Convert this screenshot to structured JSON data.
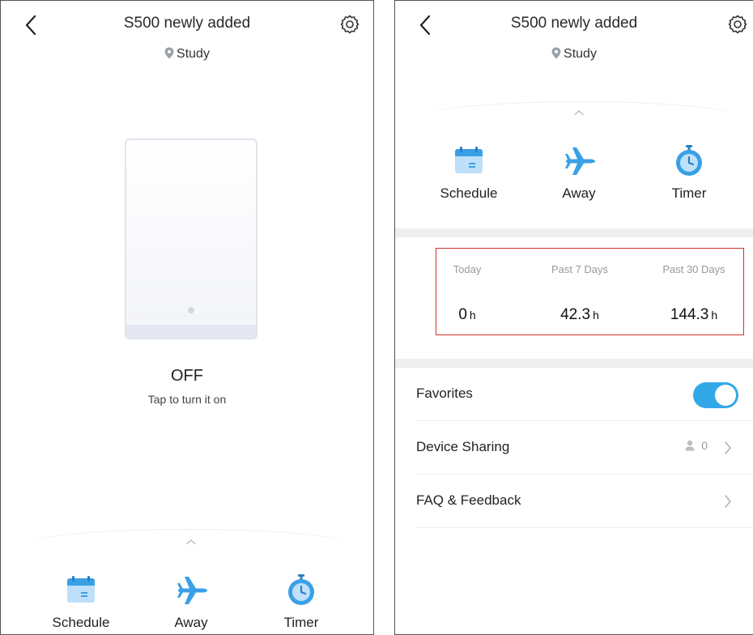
{
  "colors": {
    "accent": "#33a8e8",
    "highlight_box": "#d0312d",
    "divider": "#efefef"
  },
  "left": {
    "title": "S500 newly added",
    "location": "Study",
    "device_state": "OFF",
    "device_hint": "Tap to turn it on",
    "features": [
      {
        "label": "Schedule",
        "icon": "calendar-icon"
      },
      {
        "label": "Away",
        "icon": "airplane-icon"
      },
      {
        "label": "Timer",
        "icon": "stopwatch-icon"
      }
    ]
  },
  "right": {
    "title": "S500 newly added",
    "location": "Study",
    "features": [
      {
        "label": "Schedule",
        "icon": "calendar-icon"
      },
      {
        "label": "Away",
        "icon": "airplane-icon"
      },
      {
        "label": "Timer",
        "icon": "stopwatch-icon"
      }
    ],
    "stats": [
      {
        "label": "Today",
        "value": "0",
        "unit": "h"
      },
      {
        "label": "Past 7 Days",
        "value": "42.3",
        "unit": "h"
      },
      {
        "label": "Past 30 Days",
        "value": "144.3",
        "unit": "h"
      }
    ],
    "favorites": {
      "label": "Favorites",
      "enabled": true
    },
    "device_sharing": {
      "label": "Device Sharing",
      "count": "0"
    },
    "faq": {
      "label": "FAQ & Feedback"
    }
  }
}
